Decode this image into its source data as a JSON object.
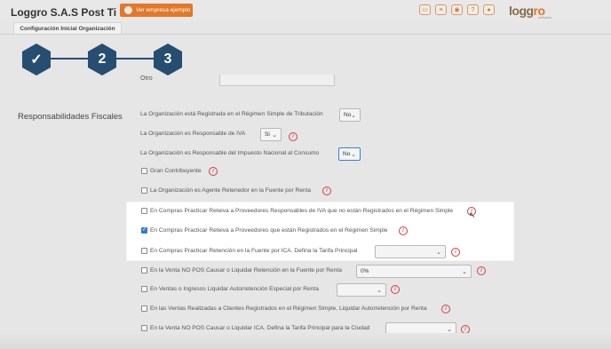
{
  "app": {
    "title": "Loggro S.A.S Post Ti",
    "demo_button": "Ver empresa ejemplo",
    "logo_main": "logg",
    "logo_accent": "ro",
    "logo_sub": "software"
  },
  "top_icons": [
    "chat-icon",
    "list-icon",
    "camera-icon",
    "help-icon",
    "user-icon",
    "settings-icon"
  ],
  "tab": {
    "label": "Configuración Inicial Organización"
  },
  "steps": [
    {
      "label": "✓"
    },
    {
      "label": "2"
    },
    {
      "label": "3"
    }
  ],
  "otro": {
    "label": "Otro",
    "value": ""
  },
  "section": {
    "title": "Responsabilidades Fiscales"
  },
  "rows": [
    {
      "text": "La Organización está Registrada en el Régimen Simple de Tributación",
      "select": "No"
    },
    {
      "text": "La Organización es Responsable de IVA",
      "select": "Si"
    },
    {
      "text": "La Organización es Responsable del Impuesto Nacional al Consumo",
      "select": "No"
    },
    {
      "text": "Gran Contribuyente"
    },
    {
      "text": "La Organización es Agente Retenedor en la Fuente por Renta"
    },
    {
      "text": "En Compras Practicar Reteiva a Proveedores Responsables de IVA que no están Registrados en el Régimen Simple"
    },
    {
      "text": "En Compras Practicar Reteiva a Proveedores que están Registrados en el Régimen Simple"
    },
    {
      "text": "En Compras Practicar Retención en la Fuente por ICA. Defina la Tarifa Principal",
      "select": ""
    },
    {
      "text": "En la Venta NO POS Causar o Liquidar Retención en la Fuente por Renta",
      "select": "0%"
    },
    {
      "text": "En Ventas o Ingresos Liquidar Autorretención Especial por Renta",
      "select": ""
    },
    {
      "text": "En las Ventas Realizadas a Clientes Registrados en el Régimen Simple, Liquidar Autorretención por Renta"
    },
    {
      "text": "En la Venta NO POS Causar o Liquidar ICA. Defina la Tarifa Principal para la Ciudad",
      "select": ""
    }
  ],
  "colors": {
    "accent": "#e3772a",
    "step": "#274e70",
    "info": "#d43c3c",
    "check": "#2f7bd8"
  }
}
